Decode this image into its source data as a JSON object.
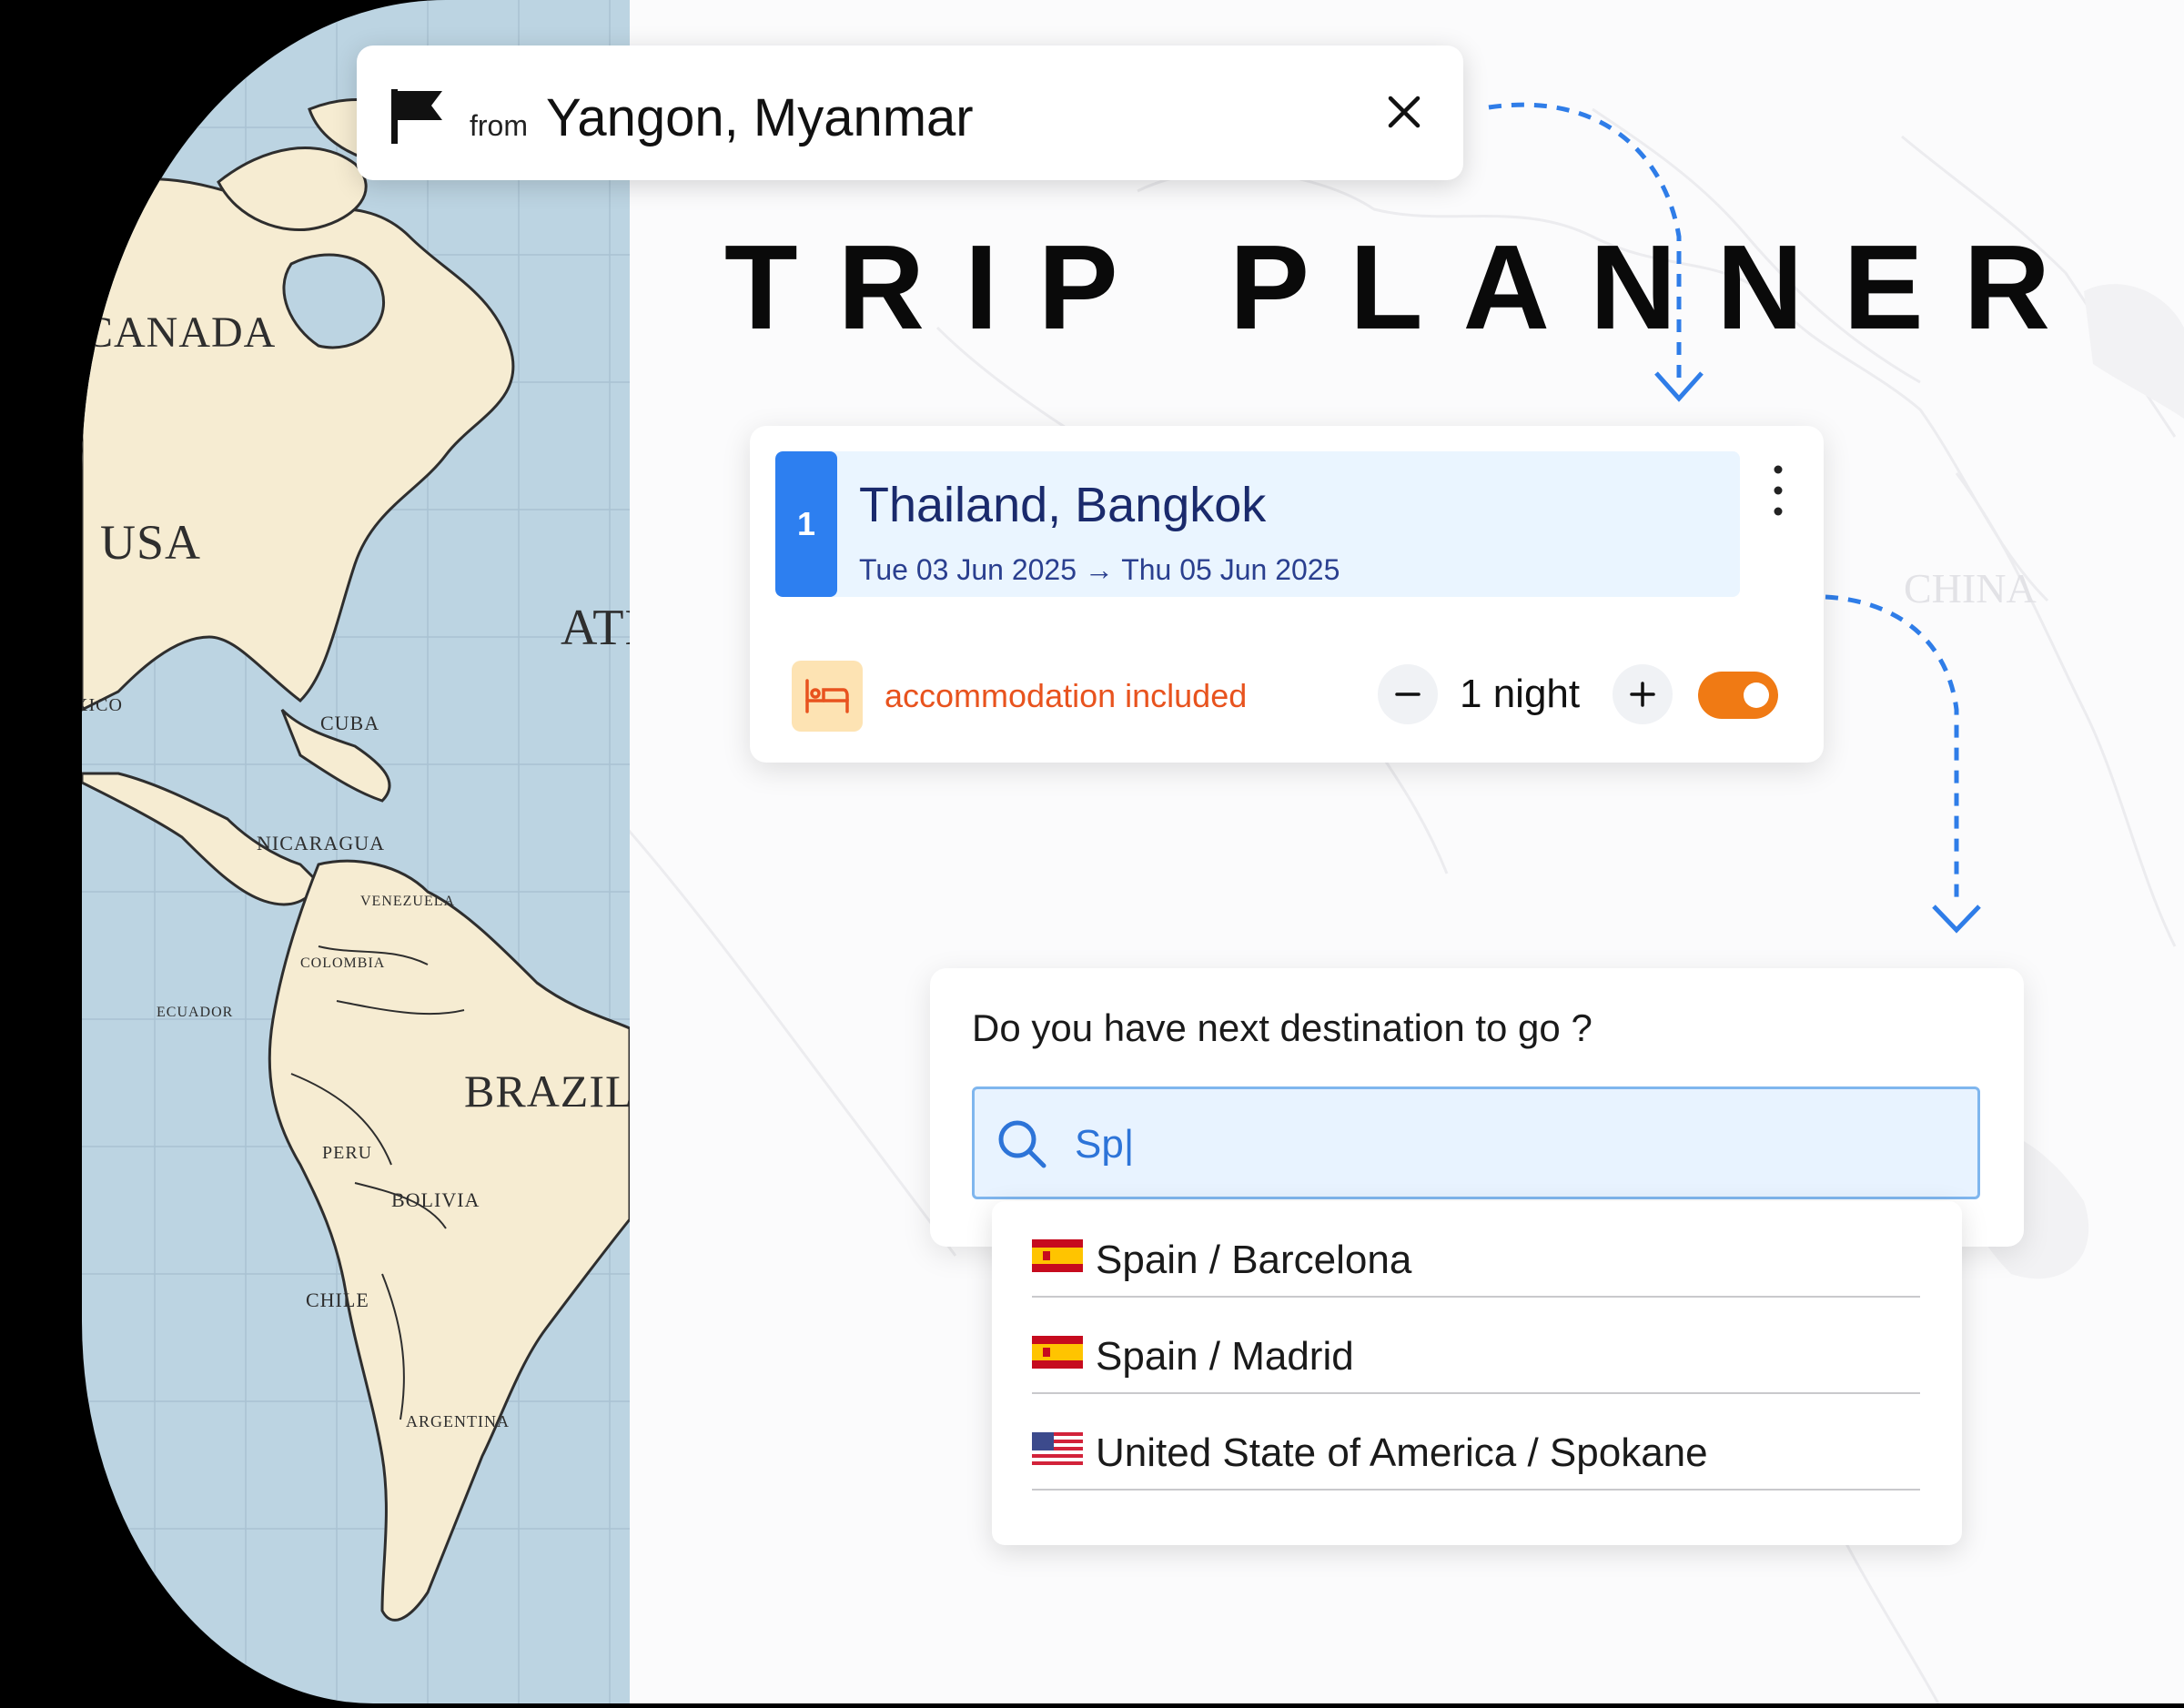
{
  "from_card": {
    "prefix": "from",
    "location": "Yangon, Myanmar",
    "flag_icon": "flag-icon",
    "close_icon": "close-icon"
  },
  "title": "TRIP PLANNER",
  "map": {
    "labels": [
      "CANADA",
      "USA",
      "ATLANTIC OCEAN",
      "CUBA",
      "NICARAGUA",
      "VENEZUELA",
      "COLOMBIA",
      "ECUADOR",
      "BRAZIL",
      "PERU",
      "BOLIVIA",
      "CHILE",
      "ARGENTINA",
      "MEXICO"
    ],
    "faint_labels": [
      "CHINA"
    ]
  },
  "destination": {
    "stop_number": "1",
    "name": "Thailand, Bangkok",
    "dates": "Tue 03 Jun 2025 → Thu 05 Jun 2025",
    "menu_icon": "more-vertical-icon",
    "accommodation_label": "accommodation included",
    "accommodation_icon": "bed-icon",
    "nights": "1 night",
    "accommodation_enabled": true,
    "accent_color": "#2d7ff0",
    "toggle_color": "#f07a14"
  },
  "next_destination": {
    "question": "Do you have next destination to go ?",
    "search_value": "Sp|",
    "search_icon": "search-icon",
    "options": [
      {
        "label": "Spain / Barcelona",
        "flag": "spain-flag-icon"
      },
      {
        "label": "Spain / Madrid",
        "flag": "spain-flag-icon"
      },
      {
        "label": "United State of America / Spokane",
        "flag": "usa-flag-icon"
      }
    ]
  }
}
